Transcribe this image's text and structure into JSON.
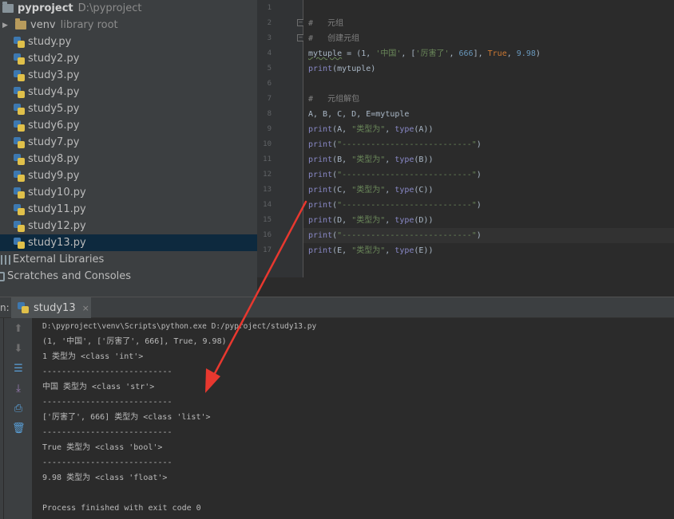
{
  "project": {
    "root_name": "pyproject",
    "root_path": "D:\\pyproject",
    "venv_name": "venv",
    "venv_hint": "library root",
    "files": [
      "study.py",
      "study2.py",
      "study3.py",
      "study4.py",
      "study5.py",
      "study6.py",
      "study7.py",
      "study8.py",
      "study9.py",
      "study10.py",
      "study11.py",
      "study12.py",
      "study13.py"
    ],
    "selected_file": "study13.py",
    "external_libraries": "External Libraries",
    "scratches": "Scratches and Consoles"
  },
  "editor": {
    "line_numbers": [
      "1",
      "2",
      "3",
      "4",
      "5",
      "6",
      "7",
      "8",
      "9",
      "10",
      "11",
      "12",
      "13",
      "14",
      "15",
      "16",
      "17"
    ],
    "current_line": 16,
    "lines": [
      [],
      [
        {
          "t": "#   元组",
          "c": "c-cmt"
        }
      ],
      [
        {
          "t": "#   创建元组",
          "c": "c-cmt"
        }
      ],
      [
        {
          "t": "mytuple",
          "c": "squig"
        },
        {
          "t": " = (1, "
        },
        {
          "t": "'中国'",
          "c": "c-str"
        },
        {
          "t": ", ["
        },
        {
          "t": "'厉害了'",
          "c": "c-str"
        },
        {
          "t": ", "
        },
        {
          "t": "666",
          "c": "c-num"
        },
        {
          "t": "], "
        },
        {
          "t": "True",
          "c": "c-kw"
        },
        {
          "t": ", "
        },
        {
          "t": "9.98",
          "c": "c-num"
        },
        {
          "t": ")"
        }
      ],
      [
        {
          "t": "print",
          "c": "c-bi"
        },
        {
          "t": "(mytuple)"
        }
      ],
      [],
      [
        {
          "t": "#   元组解包",
          "c": "c-cmt"
        }
      ],
      [
        {
          "t": "A, B, C, D, E=mytuple"
        }
      ],
      [
        {
          "t": "print",
          "c": "c-bi"
        },
        {
          "t": "(A, "
        },
        {
          "t": "\"类型为\"",
          "c": "c-str"
        },
        {
          "t": ", "
        },
        {
          "t": "type",
          "c": "c-bi"
        },
        {
          "t": "(A))"
        }
      ],
      [
        {
          "t": "print",
          "c": "c-bi"
        },
        {
          "t": "("
        },
        {
          "t": "\"---------------------------\"",
          "c": "c-str"
        },
        {
          "t": ")"
        }
      ],
      [
        {
          "t": "print",
          "c": "c-bi"
        },
        {
          "t": "(B, "
        },
        {
          "t": "\"类型为\"",
          "c": "c-str"
        },
        {
          "t": ", "
        },
        {
          "t": "type",
          "c": "c-bi"
        },
        {
          "t": "(B))"
        }
      ],
      [
        {
          "t": "print",
          "c": "c-bi"
        },
        {
          "t": "("
        },
        {
          "t": "\"---------------------------\"",
          "c": "c-str"
        },
        {
          "t": ")"
        }
      ],
      [
        {
          "t": "print",
          "c": "c-bi"
        },
        {
          "t": "(C, "
        },
        {
          "t": "\"类型为\"",
          "c": "c-str"
        },
        {
          "t": ", "
        },
        {
          "t": "type",
          "c": "c-bi"
        },
        {
          "t": "(C))"
        }
      ],
      [
        {
          "t": "print",
          "c": "c-bi"
        },
        {
          "t": "("
        },
        {
          "t": "\"---------------------------\"",
          "c": "c-str"
        },
        {
          "t": ")"
        }
      ],
      [
        {
          "t": "print",
          "c": "c-bi"
        },
        {
          "t": "(D, "
        },
        {
          "t": "\"类型为\"",
          "c": "c-str"
        },
        {
          "t": ", "
        },
        {
          "t": "type",
          "c": "c-bi"
        },
        {
          "t": "(D))"
        }
      ],
      [
        {
          "t": "print",
          "c": "c-bi"
        },
        {
          "t": "("
        },
        {
          "t": "\"---------------------------\"",
          "c": "c-str"
        },
        {
          "t": ")"
        }
      ],
      [
        {
          "t": "print",
          "c": "c-bi"
        },
        {
          "t": "(E, "
        },
        {
          "t": "\"类型为\"",
          "c": "c-str"
        },
        {
          "t": ", "
        },
        {
          "t": "type",
          "c": "c-bi"
        },
        {
          "t": "(E))"
        }
      ]
    ]
  },
  "run": {
    "prefix": "n:",
    "tab_label": "study13",
    "close_glyph": "×",
    "toolbar_icons": [
      {
        "name": "scroll-up-icon",
        "glyph": "⬆",
        "style": "disabled"
      },
      {
        "name": "scroll-down-icon",
        "glyph": "⬇",
        "style": "disabled"
      },
      {
        "name": "soft-wrap-icon",
        "glyph": "☰",
        "style": "blue"
      },
      {
        "name": "scroll-to-end-icon",
        "glyph": "⤓",
        "style": "purple"
      },
      {
        "name": "print-icon",
        "glyph": "⎙",
        "style": "blue"
      },
      {
        "name": "trash-icon",
        "glyph": "🗑",
        "style": "blue"
      }
    ],
    "output": [
      "D:\\pyproject\\venv\\Scripts\\python.exe D:/pyproject/study13.py",
      "(1, '中国', ['厉害了', 666], True, 9.98)",
      "1 类型为 <class 'int'>",
      "---------------------------",
      "中国 类型为 <class 'str'>",
      "---------------------------",
      "['厉害了', 666] 类型为 <class 'list'>",
      "---------------------------",
      "True 类型为 <class 'bool'>",
      "---------------------------",
      "9.98 类型为 <class 'float'>",
      "",
      "Process finished with exit code 0"
    ]
  },
  "colors": {
    "annotation_arrow": "#e8382f",
    "selection": "#0d293e"
  }
}
